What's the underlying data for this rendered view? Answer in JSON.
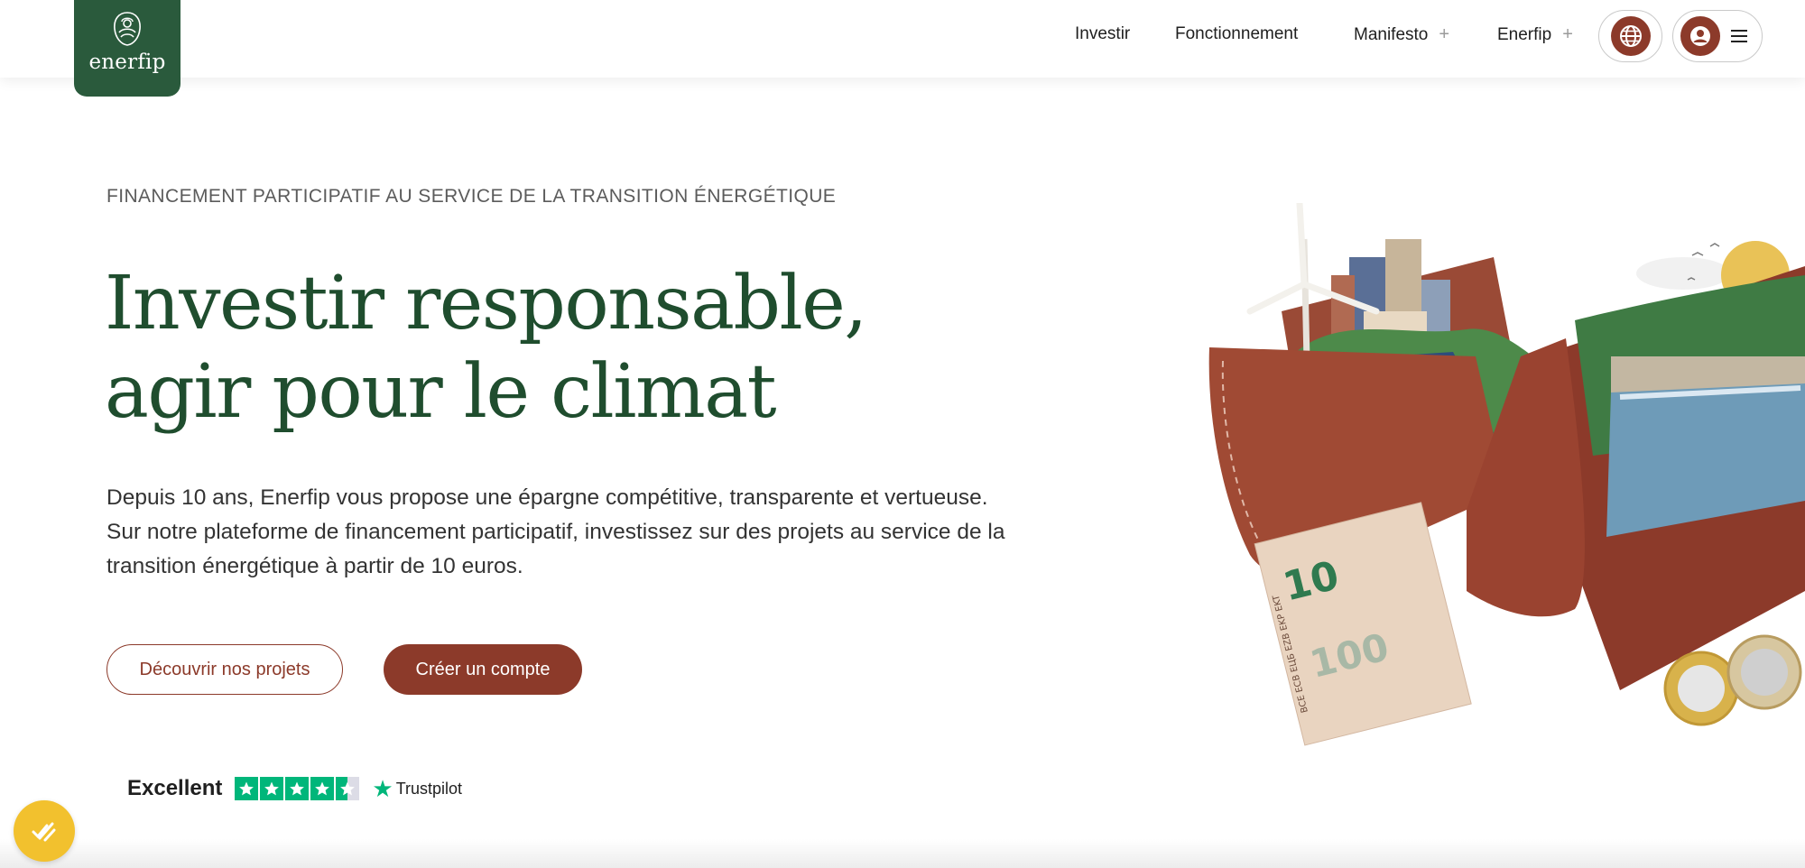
{
  "brand": {
    "name": "enerfip"
  },
  "nav": {
    "items": [
      {
        "label": "Investir",
        "plus": ""
      },
      {
        "label": "Fonctionnement",
        "plus": ""
      },
      {
        "label": "Manifesto",
        "plus": "+"
      },
      {
        "label": "Enerfip",
        "plus": "+"
      }
    ],
    "globe_icon": "globe-icon",
    "account_icon": "user-icon",
    "menu_icon": "hamburger-icon"
  },
  "hero": {
    "kicker": "FINANCEMENT PARTICIPATIF AU SERVICE DE LA TRANSITION ÉNERGÉTIQUE",
    "title_line1": "Investir responsable,",
    "title_line2": "agir pour le climat",
    "desc_line1": "Depuis 10 ans, Enerfip vous propose une épargne compétitive, transparente et vertueuse.",
    "desc_line2": "Sur notre plateforme de financement participatif, investissez sur des projets au service de la",
    "desc_line3": "transition énergétique à partir de 10 euros.",
    "btn_discover": "Découvrir nos projets",
    "btn_create": "Créer un compte"
  },
  "trustpilot": {
    "rating_label": "Excellent",
    "brand": "Trustpilot",
    "stars": 4.5
  },
  "illustration": {
    "banknote_10": "10",
    "banknote_100": "100",
    "banknote_codes": "BCE ECB ЕЦБ EZB EKP EKT"
  },
  "colors": {
    "brand_green": "#2a5a3c",
    "title_green": "#1f4d2e",
    "accent_brown": "#8c3a2a",
    "trustpilot_green": "#00b67a",
    "chat_yellow": "#f2c12e"
  }
}
